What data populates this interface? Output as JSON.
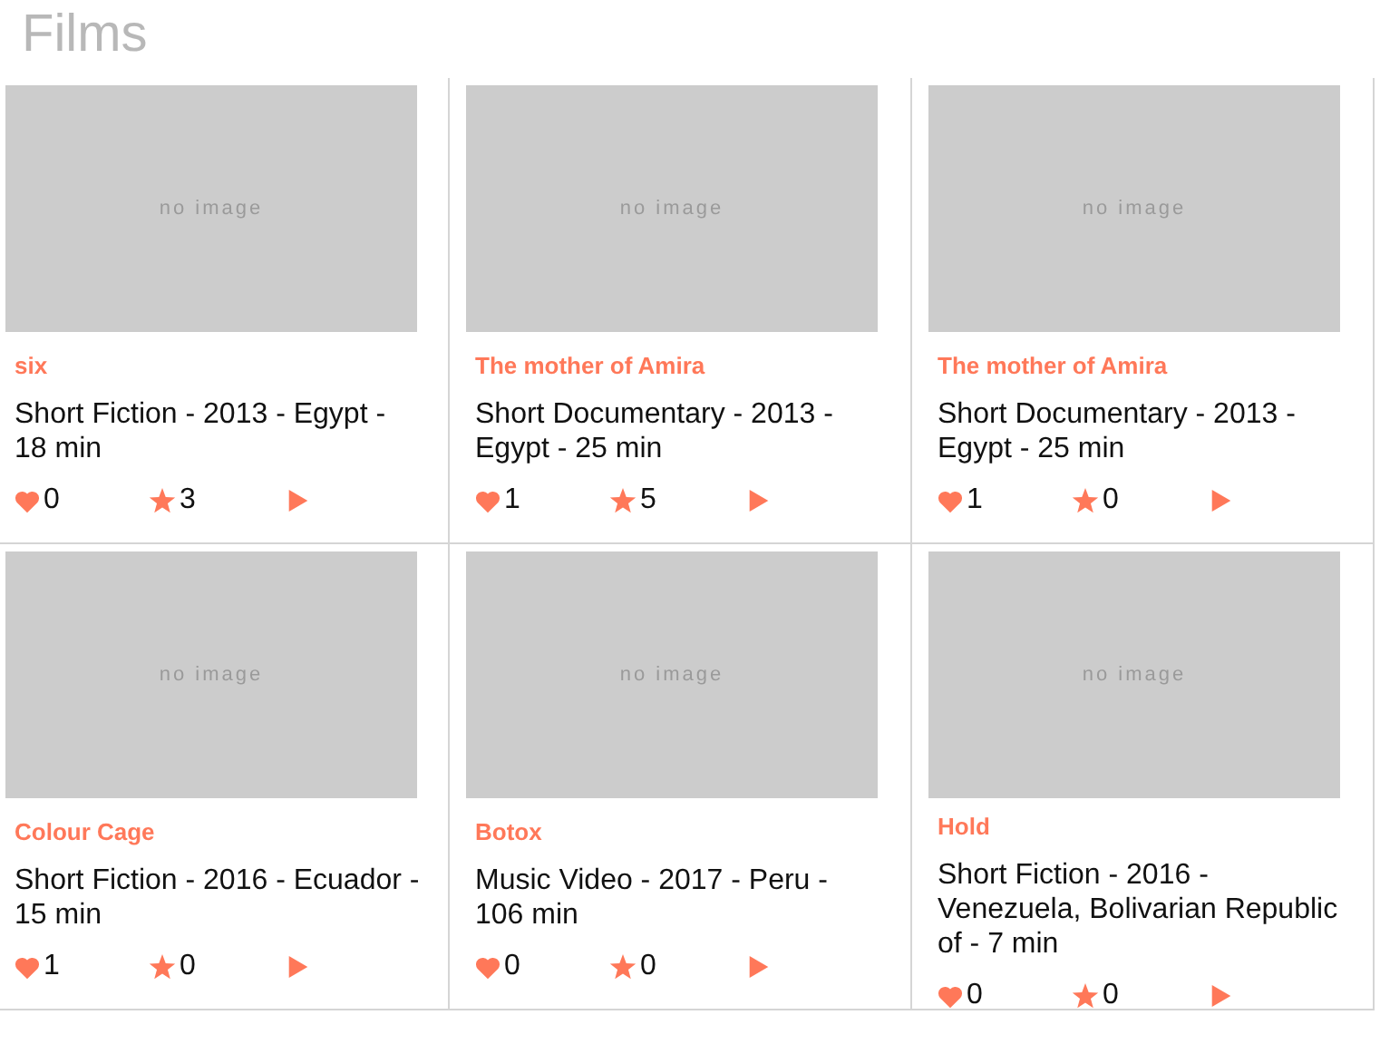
{
  "title": "Films",
  "films": [
    {
      "placeholder_text": "no image",
      "name": "six",
      "info": "Short Fiction - 2013 - Egypt - 18 min",
      "likes": "0",
      "rating": "3"
    },
    {
      "placeholder_text": "no image",
      "name": "The mother of Amira",
      "info": "Short Documentary - 2013 - Egypt - 25 min",
      "likes": "1",
      "rating": "5"
    },
    {
      "placeholder_text": "no image",
      "name": "The mother of Amira",
      "info": "Short Documentary - 2013 - Egypt - 25 min",
      "likes": "1",
      "rating": "0"
    },
    {
      "placeholder_text": "no image",
      "name": "Colour Cage",
      "info": "Short Fiction - 2016 - Ecuador - 15 min",
      "likes": "1",
      "rating": "0"
    },
    {
      "placeholder_text": "no image",
      "name": "Botox",
      "info": "Music Video - 2017 - Peru - 106 min",
      "likes": "0",
      "rating": "0"
    },
    {
      "placeholder_text": "no image",
      "name": "Hold",
      "info": "Short Fiction - 2016 - Venezuela, Bolivarian Republic of - 7 min",
      "likes": "0",
      "rating": "0"
    }
  ]
}
